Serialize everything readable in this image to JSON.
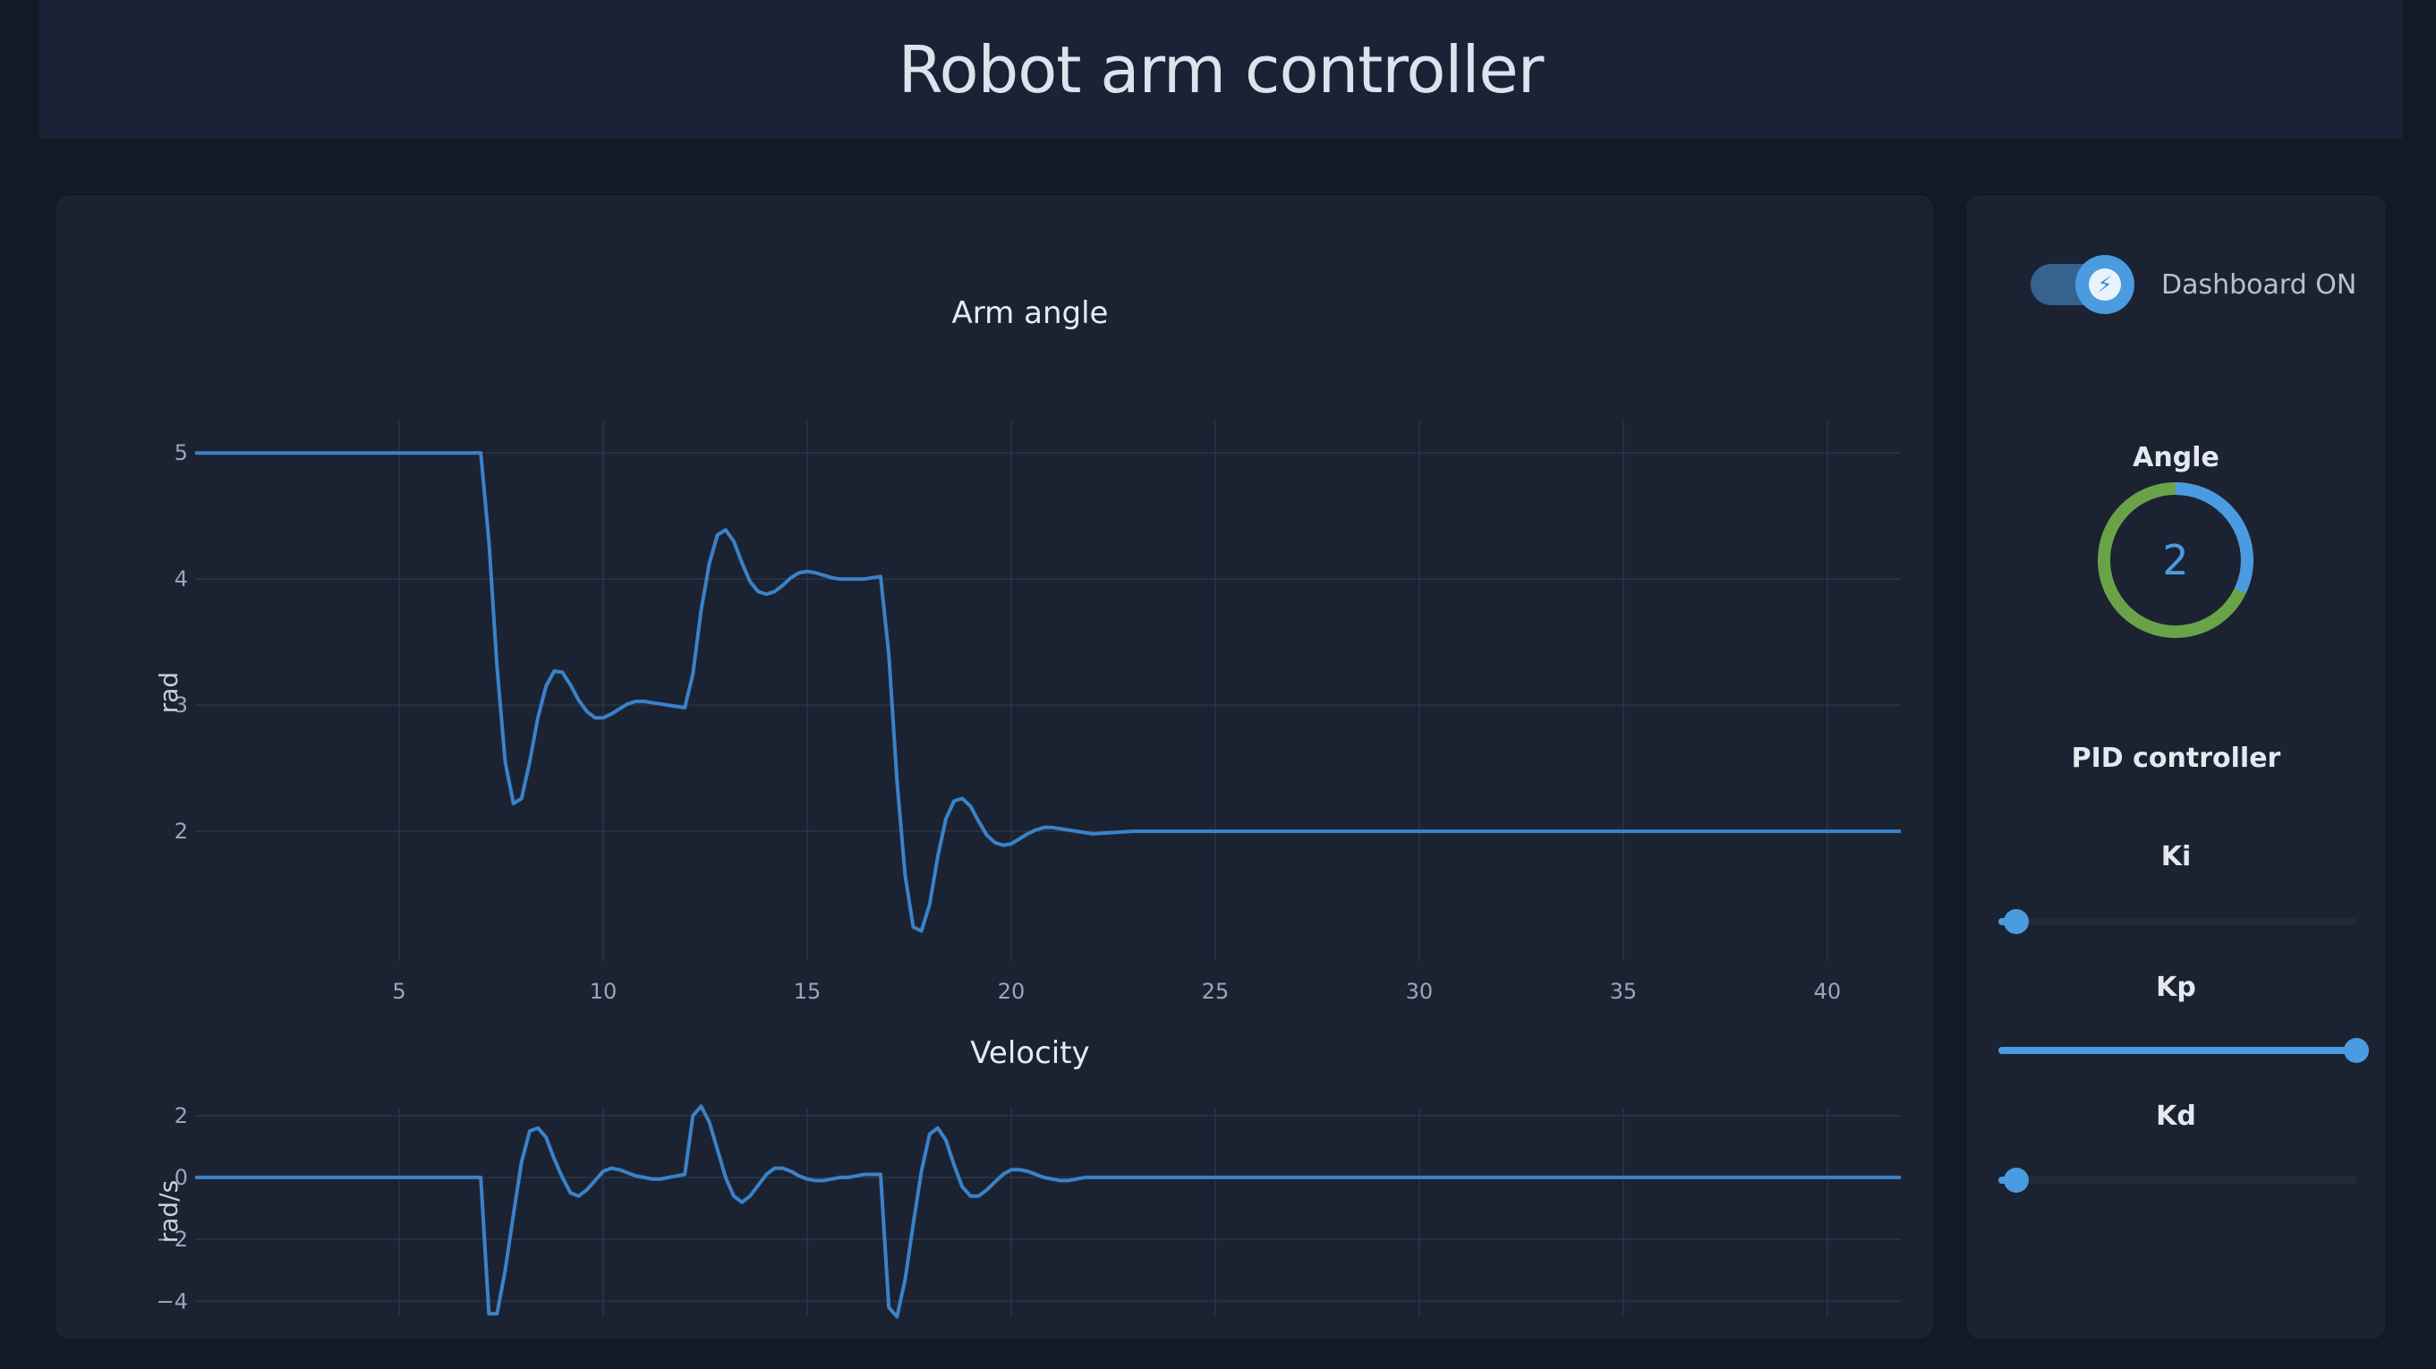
{
  "header": {
    "title": "Robot arm controller"
  },
  "sidebar": {
    "toggle_label": "Dashboard ON",
    "toggle_on": true,
    "gauge_title": "Angle",
    "gauge_value": "2",
    "gauge_fraction": 0.32,
    "pid_title": "PID controller",
    "sliders": [
      {
        "label": "Ki",
        "fraction": 0.05
      },
      {
        "label": "Kp",
        "fraction": 1.0
      },
      {
        "label": "Kd",
        "fraction": 0.05
      }
    ]
  },
  "colors": {
    "accent": "#4a9be0",
    "gauge_rest": "#6aa347",
    "line": "#3b82c8"
  },
  "chart_data": [
    {
      "type": "line",
      "title": "Arm angle",
      "xlabel": "",
      "ylabel": "rad",
      "xlim": [
        0,
        41.8
      ],
      "ylim": [
        1.0,
        5.2
      ],
      "xticks": [
        5,
        10,
        15,
        20,
        25,
        30,
        35,
        40
      ],
      "yticks": [
        2,
        3,
        4,
        5
      ],
      "grid": true,
      "series": [
        {
          "x": [
            0,
            7.0,
            7.2,
            7.4,
            7.6,
            7.8,
            8.0,
            8.2,
            8.4,
            8.6,
            8.8,
            9.0,
            9.2,
            9.4,
            9.6,
            9.8,
            10.0,
            10.2,
            10.4,
            10.6,
            10.8,
            11.0,
            11.2,
            11.4,
            11.6,
            11.8,
            12.0,
            12.2,
            12.4,
            12.6,
            12.8,
            13.0,
            13.2,
            13.4,
            13.6,
            13.8,
            14.0,
            14.2,
            14.4,
            14.6,
            14.8,
            15.0,
            15.2,
            15.4,
            15.6,
            15.8,
            16.0,
            16.2,
            16.4,
            16.6,
            16.8,
            17.0,
            17.2,
            17.4,
            17.6,
            17.8,
            18.0,
            18.2,
            18.4,
            18.6,
            18.8,
            19.0,
            19.2,
            19.4,
            19.6,
            19.8,
            20.0,
            20.2,
            20.4,
            20.6,
            20.8,
            21.0,
            21.2,
            21.4,
            21.6,
            21.8,
            22.0,
            23.0,
            25.0,
            30.0,
            35.0,
            41.8
          ],
          "y": [
            5.0,
            5.0,
            4.3,
            3.3,
            2.55,
            2.22,
            2.26,
            2.55,
            2.9,
            3.15,
            3.27,
            3.26,
            3.16,
            3.04,
            2.95,
            2.9,
            2.9,
            2.93,
            2.97,
            3.01,
            3.03,
            3.03,
            3.02,
            3.01,
            3.0,
            2.99,
            2.98,
            3.25,
            3.75,
            4.12,
            4.35,
            4.39,
            4.3,
            4.13,
            3.98,
            3.9,
            3.88,
            3.9,
            3.95,
            4.01,
            4.05,
            4.06,
            4.05,
            4.03,
            4.01,
            4.0,
            4.0,
            4.0,
            4.0,
            4.01,
            4.02,
            3.4,
            2.4,
            1.65,
            1.24,
            1.21,
            1.42,
            1.8,
            2.1,
            2.24,
            2.26,
            2.2,
            2.08,
            1.97,
            1.91,
            1.89,
            1.9,
            1.94,
            1.98,
            2.01,
            2.03,
            2.03,
            2.02,
            2.01,
            2.0,
            1.99,
            1.98,
            2.0,
            2.0,
            2.0,
            2.0,
            2.0
          ]
        }
      ]
    },
    {
      "type": "line",
      "title": "Velocity",
      "xlabel": "",
      "ylabel": "rad/s",
      "xlim": [
        0,
        41.8
      ],
      "ylim": [
        -4.8,
        2.6
      ],
      "xticks": [
        5,
        10,
        15,
        20,
        25,
        30,
        35,
        40
      ],
      "yticks": [
        2,
        0,
        -2,
        -4
      ],
      "grid": true,
      "series": [
        {
          "x": [
            0,
            7.0,
            7.2,
            7.4,
            7.6,
            7.8,
            8.0,
            8.2,
            8.4,
            8.6,
            8.8,
            9.0,
            9.2,
            9.4,
            9.6,
            9.8,
            10.0,
            10.2,
            10.4,
            10.6,
            10.8,
            11.0,
            11.2,
            11.4,
            11.6,
            11.8,
            12.0,
            12.2,
            12.4,
            12.6,
            12.8,
            13.0,
            13.2,
            13.4,
            13.6,
            13.8,
            14.0,
            14.2,
            14.4,
            14.6,
            14.8,
            15.0,
            15.2,
            15.4,
            15.6,
            15.8,
            16.0,
            16.2,
            16.4,
            16.6,
            16.8,
            17.0,
            17.2,
            17.4,
            17.6,
            17.8,
            18.0,
            18.2,
            18.4,
            18.6,
            18.8,
            19.0,
            19.2,
            19.4,
            19.6,
            19.8,
            20.0,
            20.2,
            20.4,
            20.6,
            20.8,
            21.0,
            21.2,
            21.4,
            21.6,
            21.8,
            22.0,
            23.0,
            25.0,
            30.0,
            35.0,
            41.8
          ],
          "y": [
            0,
            0,
            -4.4,
            -4.4,
            -3.0,
            -1.2,
            0.5,
            1.5,
            1.6,
            1.3,
            0.6,
            0.0,
            -0.5,
            -0.6,
            -0.4,
            -0.1,
            0.2,
            0.3,
            0.25,
            0.15,
            0.05,
            0.0,
            -0.05,
            -0.05,
            0.0,
            0.05,
            0.1,
            2.0,
            2.3,
            1.8,
            0.9,
            0.0,
            -0.6,
            -0.8,
            -0.6,
            -0.25,
            0.1,
            0.3,
            0.3,
            0.2,
            0.05,
            -0.05,
            -0.1,
            -0.1,
            -0.05,
            0.0,
            0.0,
            0.05,
            0.1,
            0.1,
            0.1,
            -4.2,
            -4.5,
            -3.3,
            -1.5,
            0.2,
            1.4,
            1.6,
            1.2,
            0.4,
            -0.3,
            -0.6,
            -0.6,
            -0.4,
            -0.15,
            0.1,
            0.25,
            0.25,
            0.2,
            0.1,
            0.0,
            -0.05,
            -0.1,
            -0.1,
            -0.05,
            0.0,
            0.0,
            0.0,
            0.0,
            0.0,
            0.0,
            0.0
          ]
        }
      ]
    }
  ]
}
